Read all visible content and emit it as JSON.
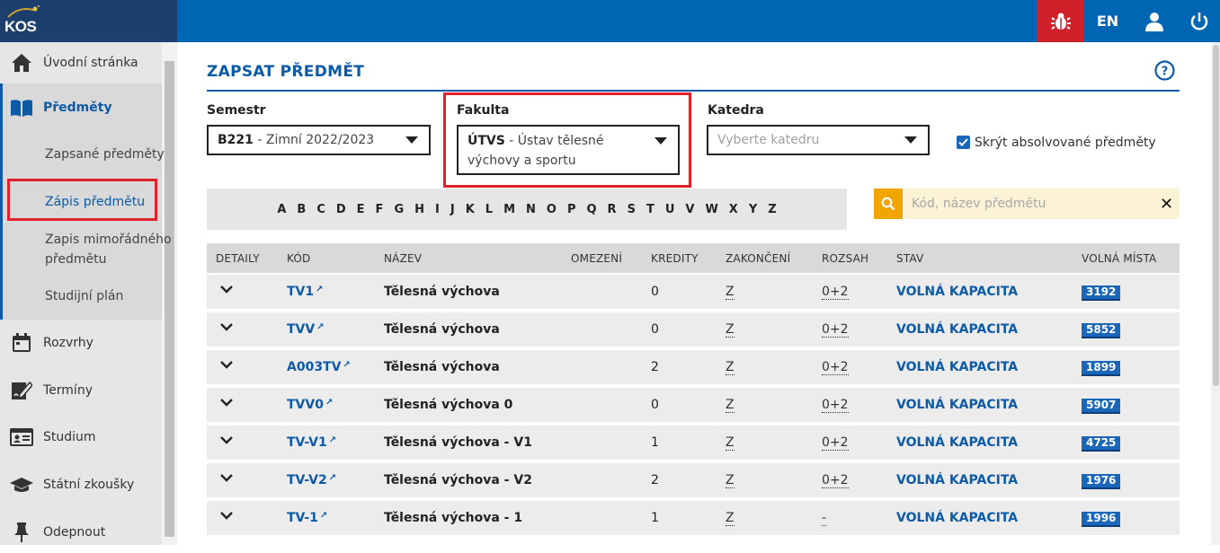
{
  "app": {
    "logo": "KOS"
  },
  "topbar": {
    "lang": "EN"
  },
  "sidebar": {
    "items": [
      {
        "label": "Úvodní stránka",
        "icon": "home-icon"
      },
      {
        "label": "Předměty",
        "icon": "book-icon"
      },
      {
        "label": "Rozvrhy",
        "icon": "calendar-icon"
      },
      {
        "label": "Termíny",
        "icon": "edit-icon"
      },
      {
        "label": "Studium",
        "icon": "id-card-icon"
      },
      {
        "label": "Státní zkoušky",
        "icon": "graduation-cap-icon"
      },
      {
        "label": "Odepnout",
        "icon": "pin-icon"
      }
    ],
    "subitems": [
      {
        "label": "Zapsané předměty"
      },
      {
        "label": "Zápis předmětu"
      },
      {
        "label": "Zapis mimořádného"
      },
      {
        "label": "předmětu"
      },
      {
        "label": "Studijní plán"
      }
    ]
  },
  "page": {
    "title": "ZAPSAT PŘEDMĚT"
  },
  "filters": {
    "semestr_label": "Semestr",
    "semestr_code": "B221",
    "semestr_text": " - Zimní 2022/2023",
    "fakulta_label": "Fakulta",
    "fakulta_code": "ÚTVS",
    "fakulta_text": " - Ústav tělesné",
    "fakulta_text2": "výchovy a sportu",
    "katedra_label": "Katedra",
    "katedra_placeholder": "Vyberte katedru",
    "hide_label": "Skrýt absolvované předměty",
    "hide_checked": true
  },
  "alphabet": [
    "A",
    "B",
    "C",
    "D",
    "E",
    "F",
    "G",
    "H",
    "I",
    "J",
    "K",
    "L",
    "M",
    "N",
    "O",
    "P",
    "Q",
    "R",
    "S",
    "T",
    "U",
    "V",
    "W",
    "X",
    "Y",
    "Z"
  ],
  "search": {
    "placeholder": "Kód, název předmětu"
  },
  "table": {
    "headers": [
      "DETAILY",
      "KÓD",
      "NÁZEV",
      "OMEZENÍ",
      "KREDITY",
      "ZAKONČENÍ",
      "ROZSAH",
      "STAV",
      "VOLNÁ MÍSTA"
    ],
    "rows": [
      {
        "code": "TV1",
        "name": "Tělesná výchova",
        "credits": "0",
        "end": "Z",
        "range": "0+2",
        "status": "VOLNÁ KAPACITA",
        "free": "3192"
      },
      {
        "code": "TVV",
        "name": "Tělesná výchova",
        "credits": "0",
        "end": "Z",
        "range": "0+2",
        "status": "VOLNÁ KAPACITA",
        "free": "5852"
      },
      {
        "code": "A003TV",
        "name": "Tělesná výchova",
        "credits": "2",
        "end": "Z",
        "range": "0+2",
        "status": "VOLNÁ KAPACITA",
        "free": "1899"
      },
      {
        "code": "TVV0",
        "name": "Tělesná výchova 0",
        "credits": "0",
        "end": "Z",
        "range": "0+2",
        "status": "VOLNÁ KAPACITA",
        "free": "5907"
      },
      {
        "code": "TV-V1",
        "name": "Tělesná výchova - V1",
        "credits": "1",
        "end": "Z",
        "range": "0+2",
        "status": "VOLNÁ KAPACITA",
        "free": "4725"
      },
      {
        "code": "TV-V2",
        "name": "Tělesná výchova - V2",
        "credits": "2",
        "end": "Z",
        "range": "0+2",
        "status": "VOLNÁ KAPACITA",
        "free": "1976"
      },
      {
        "code": "TV-1",
        "name": "Tělesná výchova - 1",
        "credits": "1",
        "end": "Z",
        "range": "-",
        "status": "VOLNÁ KAPACITA",
        "free": "1996"
      }
    ]
  },
  "colors": {
    "topbar": "#0066b3",
    "accent": "#0d5aa7",
    "alert": "#d0202a",
    "search_icon_bg": "#f0a500"
  }
}
